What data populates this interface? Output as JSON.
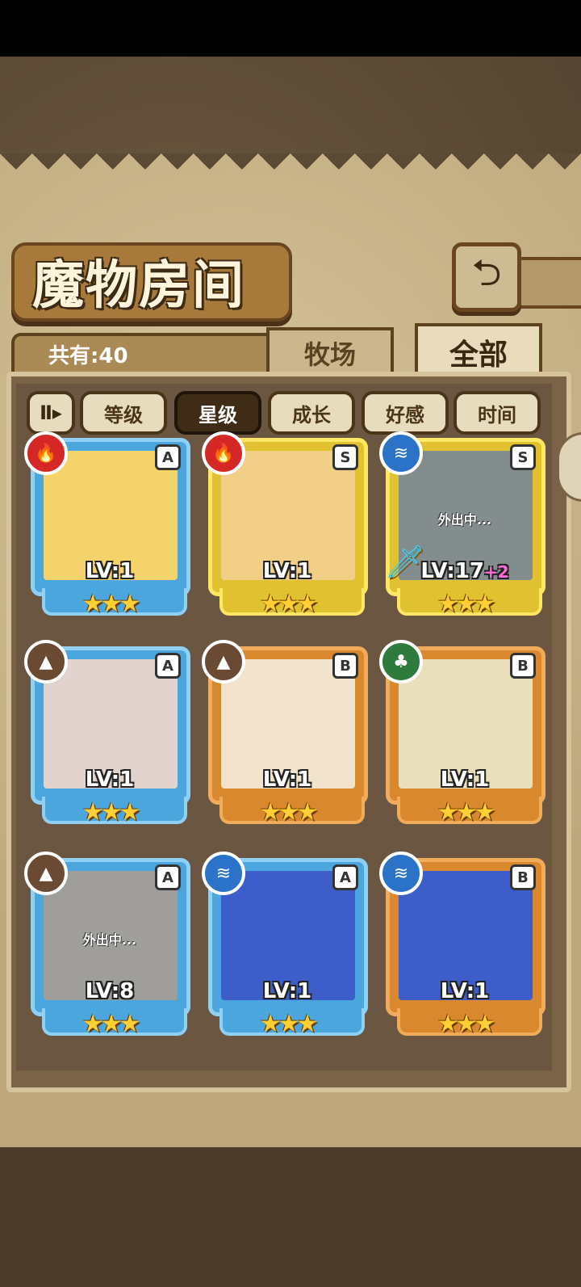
{
  "header": {
    "title": "魔物房间",
    "back_icon": "return-arrow-icon"
  },
  "summary": {
    "count_label": "共有:40"
  },
  "tabs": [
    {
      "label": "牧场",
      "active": false
    },
    {
      "label": "全部",
      "active": true
    }
  ],
  "sort": {
    "toggle_label": "Ⅱ▸",
    "buttons": [
      {
        "label": "等级",
        "active": false
      },
      {
        "label": "星级",
        "active": true
      },
      {
        "label": "成长",
        "active": false
      },
      {
        "label": "好感",
        "active": false
      },
      {
        "label": "时间",
        "active": false
      }
    ]
  },
  "monsters": [
    {
      "element": "fire",
      "element_icon": "🔥",
      "grade": "A",
      "frame": "blue",
      "level": "LV:1",
      "bonus": "",
      "stars": "★★★",
      "away": "",
      "art_color": "#f4d36a"
    },
    {
      "element": "fire",
      "element_icon": "🔥",
      "grade": "S",
      "frame": "yellow",
      "level": "LV:1",
      "bonus": "",
      "stars": "★★★",
      "away": "",
      "art_color": "#f1cf87"
    },
    {
      "element": "water",
      "element_icon": "≋",
      "grade": "S",
      "frame": "yellow",
      "level": "LV:17",
      "bonus": "+2",
      "stars": "★★★",
      "away": "外出中...",
      "art_color": "#8fb6b5"
    },
    {
      "element": "earth",
      "element_icon": "▲",
      "grade": "A",
      "frame": "blue",
      "level": "LV:1",
      "bonus": "",
      "stars": "★★★",
      "away": "",
      "art_color": "#e3d3cf"
    },
    {
      "element": "earth",
      "element_icon": "▲",
      "grade": "B",
      "frame": "orange",
      "level": "LV:1",
      "bonus": "",
      "stars": "★★★",
      "away": "",
      "art_color": "#f2e3cc"
    },
    {
      "element": "wind",
      "element_icon": "♣",
      "grade": "B",
      "frame": "orange",
      "level": "LV:1",
      "bonus": "",
      "stars": "★★★",
      "away": "",
      "art_color": "#e9dfbb"
    },
    {
      "element": "earth",
      "element_icon": "▲",
      "grade": "A",
      "frame": "blue",
      "level": "LV:8",
      "bonus": "",
      "stars": "★★★",
      "away": "外出中...",
      "art_color": "#cfc4b5"
    },
    {
      "element": "water",
      "element_icon": "≋",
      "grade": "A",
      "frame": "blue",
      "level": "LV:1",
      "bonus": "",
      "stars": "★★★",
      "away": "",
      "art_color": "#3d5ec9"
    },
    {
      "element": "water",
      "element_icon": "≋",
      "grade": "B",
      "frame": "orange",
      "level": "LV:1",
      "bonus": "",
      "stars": "★★★",
      "away": "",
      "art_color": "#3d5ec9"
    }
  ]
}
